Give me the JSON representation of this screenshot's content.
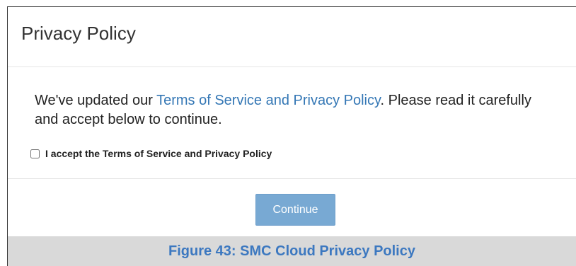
{
  "dialog": {
    "title": "Privacy Policy",
    "message_prefix": "We've updated our ",
    "message_link": "Terms of Service and Privacy Policy",
    "message_suffix": ". Please read it carefully and accept below to continue.",
    "accept_label": "I accept the Terms of Service and Privacy Policy",
    "accept_checked": false,
    "continue_label": "Continue"
  },
  "caption": {
    "text": "Figure 43: SMC Cloud Privacy Policy"
  },
  "colors": {
    "link": "#3477b5",
    "button_disabled": "#78a9d3",
    "caption_text": "#3c78c0",
    "caption_background": "#d9d9d9"
  }
}
